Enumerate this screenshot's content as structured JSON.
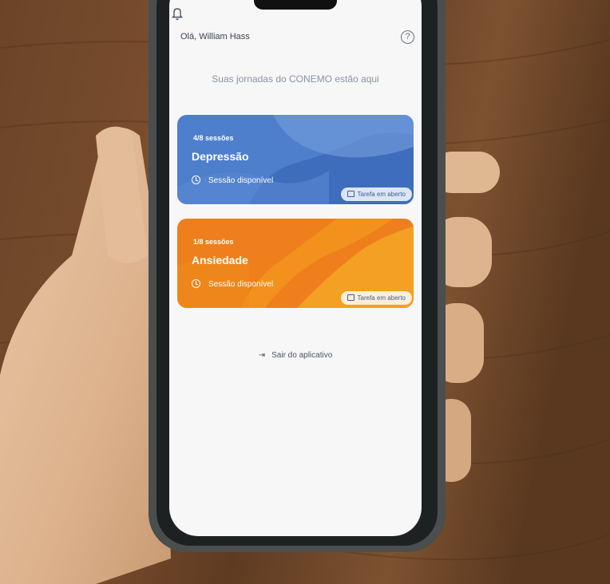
{
  "header": {
    "greeting": "Olá, William Hass",
    "notification_icon": "bell-icon",
    "help_icon": "help-icon"
  },
  "subtitle": "Suas jornadas do CONEMO estão aqui",
  "cards": [
    {
      "sessions": "4/8 sessões",
      "title": "Depressão",
      "availability": "Sessão disponível",
      "task": "Tarefa em aberto",
      "color": "#4d7fcd"
    },
    {
      "sessions": "1/8 sessões",
      "title": "Ansiedade",
      "availability": "Sessão disponível",
      "task": "Tarefa em aberto",
      "color": "#ee7f1c"
    }
  ],
  "logout": "Sair do aplicativo"
}
